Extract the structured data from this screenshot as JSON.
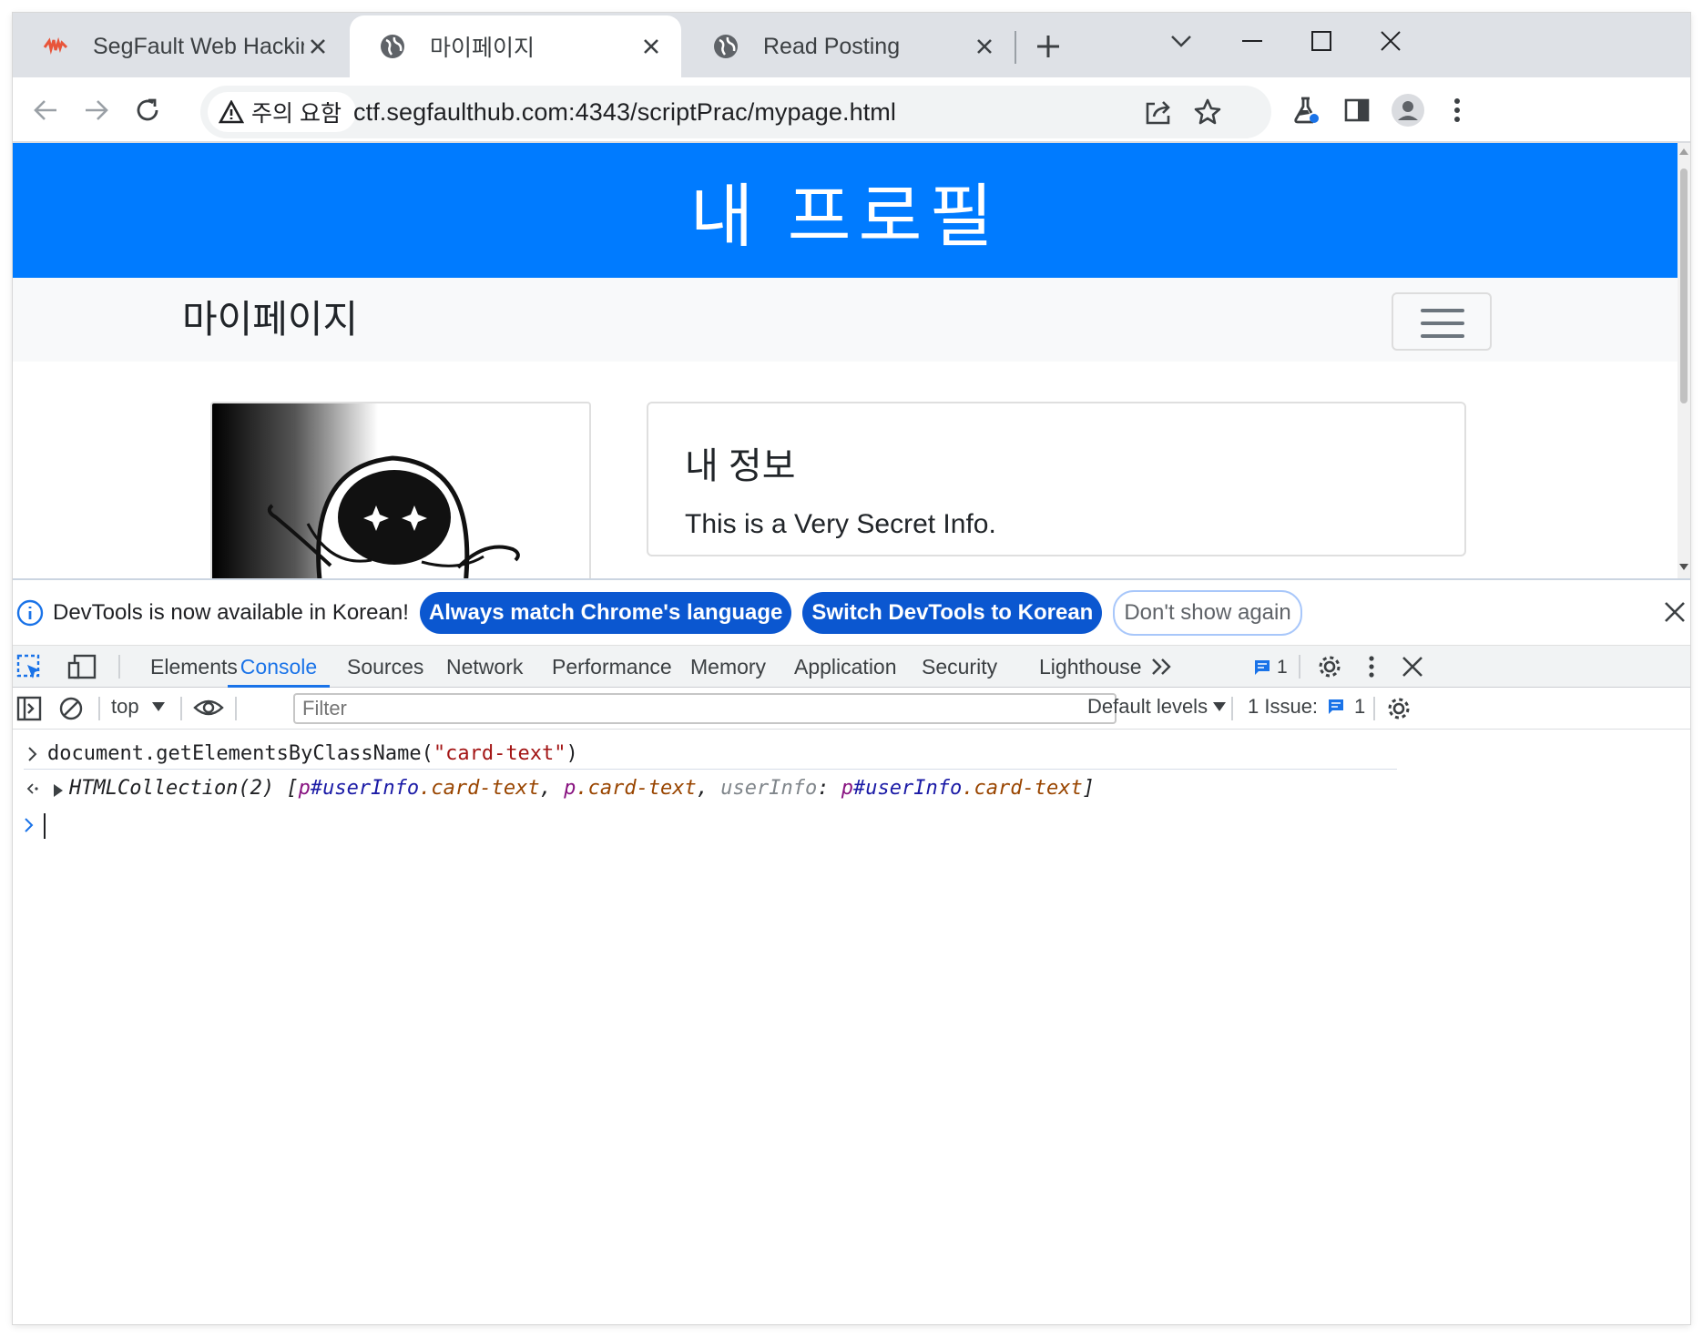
{
  "browser": {
    "tabs": [
      {
        "title": "SegFault Web Hacking Train",
        "favicon": "segfault-logo-icon"
      },
      {
        "title": "마이페이지",
        "favicon": "globe-icon",
        "active": true
      },
      {
        "title": "Read Posting",
        "favicon": "globe-icon"
      }
    ],
    "security_chip": "주의 요함",
    "url": "ctf.segfaulthub.com:4343/scriptPrac/mypage.html"
  },
  "page": {
    "hero_title": "내 프로필",
    "navbar_brand": "마이페이지",
    "info_card": {
      "title": "내 정보",
      "text": "This is a Very Secret Info."
    },
    "colors": {
      "hero": "#007bff",
      "navbar": "#f8f9fa"
    }
  },
  "devtools": {
    "infobar": {
      "message": "DevTools is now available in Korean!",
      "btn_match": "Always match Chrome's language",
      "btn_switch": "Switch DevTools to Korean",
      "btn_dismiss": "Don't show again"
    },
    "tabs": [
      "Elements",
      "Console",
      "Sources",
      "Network",
      "Performance",
      "Memory",
      "Application",
      "Security",
      "Lighthouse"
    ],
    "active_tab": "Console",
    "messages_badge": "1",
    "console_toolbar": {
      "context": "top",
      "filter_placeholder": "Filter",
      "levels": "Default levels",
      "issues_label": "1 Issue:",
      "issues_count": "1"
    },
    "console": {
      "input_command_pre": "document.getElementsByClassName(",
      "input_command_arg": "\"card-text\"",
      "input_command_post": ")",
      "result": {
        "type": "HTMLCollection(2)",
        "open": "[",
        "item1_tag": "p",
        "item1_id": "#userInfo",
        "item1_class": ".card-text",
        "comma": ",",
        "item2_tag": "p",
        "item2_class": ".card-text",
        "key": "userInfo",
        "colon": ":",
        "close": "]"
      }
    }
  }
}
